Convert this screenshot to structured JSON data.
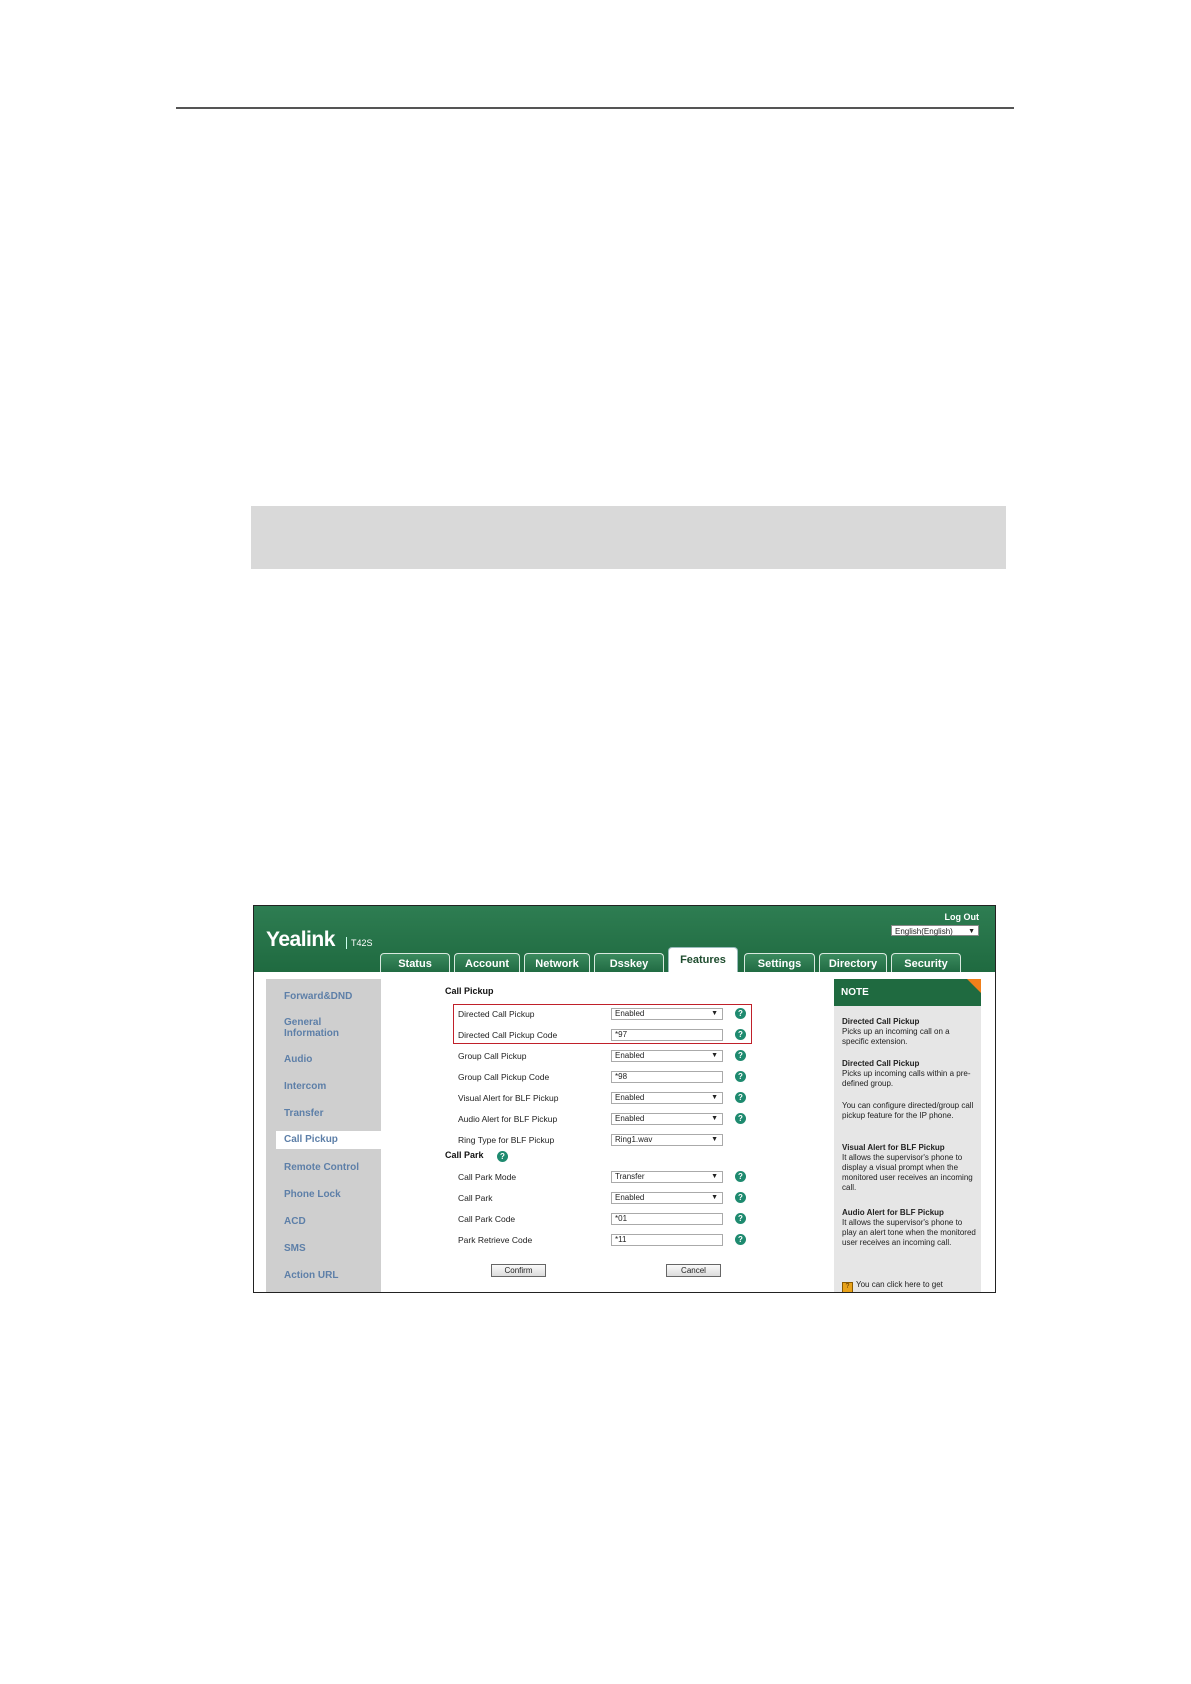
{
  "app": {
    "logo": "Yealink",
    "model": "T42S",
    "logout": "Log Out",
    "language": "English(English)"
  },
  "tabs": [
    "Status",
    "Account",
    "Network",
    "Dsskey",
    "Features",
    "Settings",
    "Directory",
    "Security"
  ],
  "active_tab": "Features",
  "nav": {
    "items": [
      "Forward&DND",
      "General Information",
      "Audio",
      "Intercom",
      "Transfer",
      "Call Pickup",
      "Remote Control",
      "Phone Lock",
      "ACD",
      "SMS",
      "Action URL"
    ],
    "active": "Call Pickup"
  },
  "call_pickup": {
    "title": "Call Pickup",
    "fields": [
      {
        "label": "Directed Call Pickup",
        "value": "Enabled",
        "type": "select"
      },
      {
        "label": "Directed Call Pickup Code",
        "value": "*97",
        "type": "input"
      },
      {
        "label": "Group Call Pickup",
        "value": "Enabled",
        "type": "select"
      },
      {
        "label": "Group Call Pickup Code",
        "value": "*98",
        "type": "input"
      },
      {
        "label": "Visual Alert for BLF Pickup",
        "value": "Enabled",
        "type": "select"
      },
      {
        "label": "Audio Alert for BLF Pickup",
        "value": "Enabled",
        "type": "select"
      },
      {
        "label": "Ring Type for BLF Pickup",
        "value": "Ring1.wav",
        "type": "select"
      }
    ]
  },
  "call_park": {
    "title": "Call Park",
    "fields": [
      {
        "label": "Call Park Mode",
        "value": "Transfer",
        "type": "select"
      },
      {
        "label": "Call Park",
        "value": "Enabled",
        "type": "select"
      },
      {
        "label": "Call Park Code",
        "value": "*01",
        "type": "input"
      },
      {
        "label": "Park Retrieve Code",
        "value": "*11",
        "type": "input"
      }
    ]
  },
  "buttons": {
    "confirm": "Confirm",
    "cancel": "Cancel"
  },
  "note": {
    "title": "NOTE",
    "blocks": [
      {
        "heading": "Directed Call Pickup",
        "text": "Picks up an incoming call on a specific extension."
      },
      {
        "heading": "Directed Call Pickup",
        "text": "Picks up incoming calls within a pre-defined group."
      },
      {
        "heading": "",
        "text": "You can configure directed/group call pickup feature for the IP phone."
      },
      {
        "heading": "Visual Alert for BLF Pickup",
        "text": "It allows the supervisor's phone to display a visual prompt when the monitored user receives an incoming call."
      },
      {
        "heading": "Audio Alert for BLF Pickup",
        "text": "It allows the supervisor's phone to play an alert tone when the monitored user receives an incoming call."
      }
    ],
    "footer": "You can click here to get"
  },
  "colors": {
    "brand_green": "#1f6a40",
    "highlight_red": "#c0202a",
    "note_accent": "#f07f1a",
    "help_icon": "#1e8a6f"
  }
}
